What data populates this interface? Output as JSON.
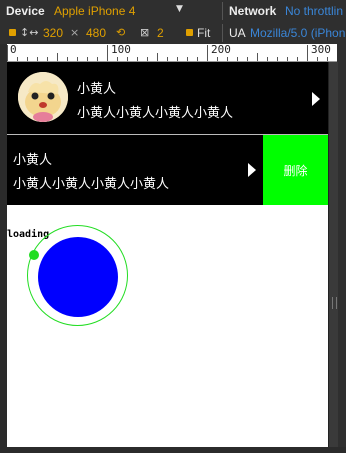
{
  "devtools": {
    "device_label": "Device",
    "device_value": "Apple iPhone 4",
    "network_label": "Network",
    "network_value": "No throttlin",
    "width_value": "320",
    "times": "×",
    "height_value": "480",
    "dpr_value": "2",
    "fit_label": "Fit",
    "ua_label": "UA",
    "ua_value": "Mozilla/5.0 (iPhon"
  },
  "ruler": {
    "labels": [
      "0",
      "100",
      "200",
      "300"
    ]
  },
  "list": {
    "item1": {
      "title": "小黄人",
      "subtitle": "小黄人小黄人小黄人小黄人"
    },
    "item2": {
      "title": "小黄人",
      "subtitle": "小黄人小黄人小黄人小黄人",
      "delete_label": "删除"
    }
  },
  "loading": {
    "text": "loading"
  },
  "colors": {
    "ball": "#0000ff",
    "dot": "#22dd22",
    "ring": "#22dd22",
    "delete_bg": "#00ff00",
    "accent_orange": "#e0a000",
    "accent_blue": "#3a86d8"
  }
}
